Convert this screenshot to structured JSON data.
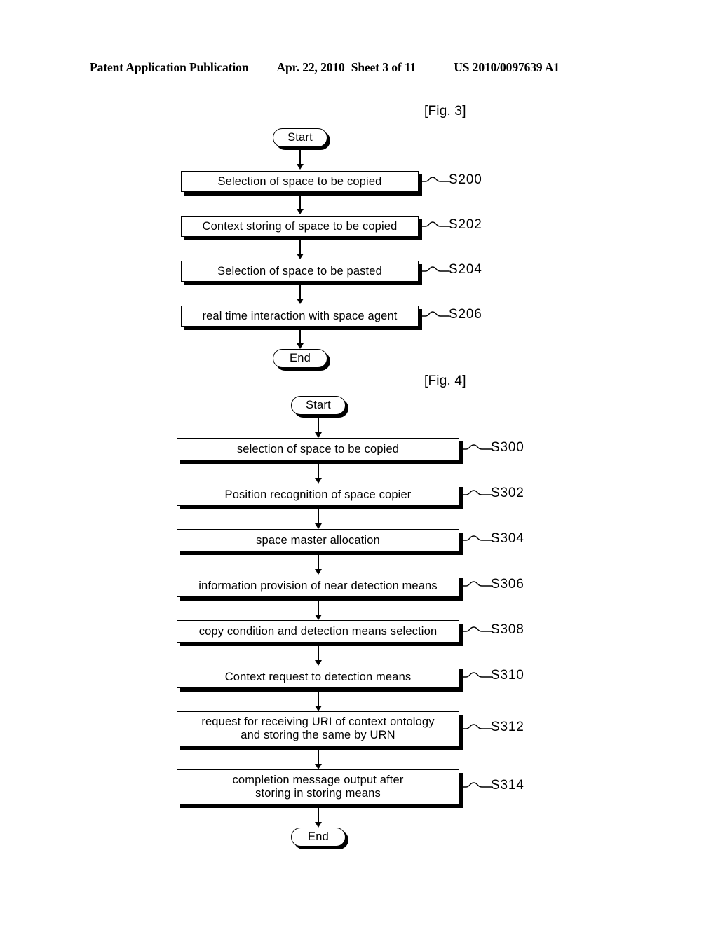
{
  "header": {
    "publication": "Patent Application Publication",
    "date": "Apr. 22, 2010",
    "sheet": "Sheet 3 of 11",
    "patent_number": "US 2010/0097639 A1"
  },
  "figures": [
    {
      "label": "[Fig. 3]",
      "start_label": "Start",
      "end_label": "End",
      "steps": [
        {
          "text": "Selection of space to be copied",
          "ref": "S200"
        },
        {
          "text": "Context storing of space to be copied",
          "ref": "S202"
        },
        {
          "text": "Selection of space to be pasted",
          "ref": "S204"
        },
        {
          "text": "real time interaction with space agent",
          "ref": "S206"
        }
      ]
    },
    {
      "label": "[Fig. 4]",
      "start_label": "Start",
      "end_label": "End",
      "steps": [
        {
          "text": "selection of space to be copied",
          "ref": "S300"
        },
        {
          "text": "Position recognition of space copier",
          "ref": "S302"
        },
        {
          "text": "space master allocation",
          "ref": "S304"
        },
        {
          "text": "information provision of near detection means",
          "ref": "S306"
        },
        {
          "text": "copy condition and detection means  selection",
          "ref": "S308"
        },
        {
          "text": "Context request to detection means",
          "ref": "S310"
        },
        {
          "text": "request for receiving URI of context ontology\nand storing the same by URN",
          "ref": "S312"
        },
        {
          "text": "completion message output after\nstoring in storing means",
          "ref": "S314"
        }
      ]
    }
  ]
}
